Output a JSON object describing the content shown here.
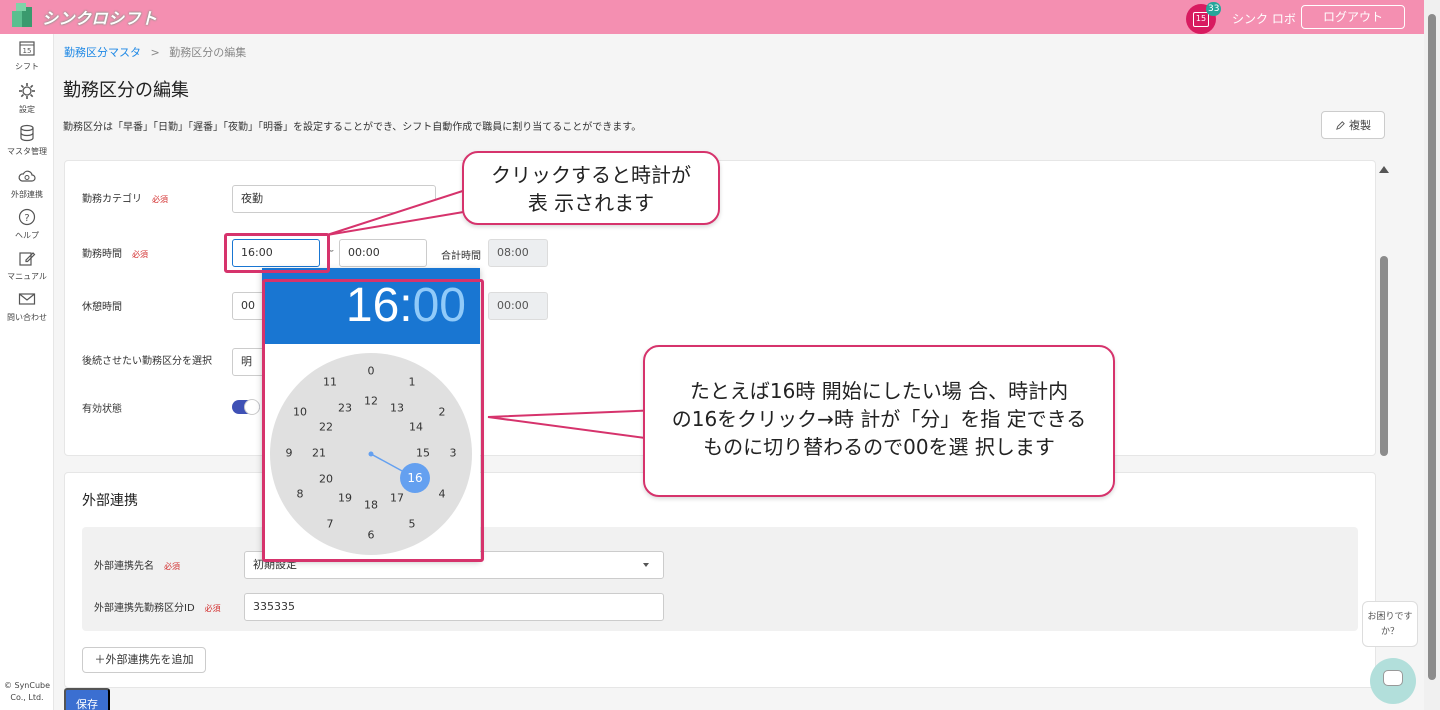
{
  "header": {
    "logo_text": "シンクロシフト",
    "notification_count": "33",
    "calendar_day": "15",
    "user_name": "シンク ロボ",
    "logout_label": "ログアウト"
  },
  "sidebar": {
    "items": [
      {
        "label": "シフト",
        "icon": "calendar-icon",
        "icon_text": "15"
      },
      {
        "label": "設定",
        "icon": "gear-icon"
      },
      {
        "label": "マスタ管理",
        "icon": "database-icon"
      },
      {
        "label": "外部連携",
        "icon": "cloud-sync-icon"
      },
      {
        "label": "ヘルプ",
        "icon": "help-icon"
      },
      {
        "label": "マニュアル",
        "icon": "edit-icon"
      },
      {
        "label": "問い合わせ",
        "icon": "mail-icon"
      }
    ],
    "copyright": "© SynCube Co., Ltd."
  },
  "breadcrumb": {
    "parent": "勤務区分マスタ",
    "separator": ">",
    "current": "勤務区分の編集"
  },
  "page": {
    "title": "勤務区分の編集",
    "description": "勤務区分は「早番」「日勤」「遅番」「夜勤」「明番」を設定することができ、シフト自動作成で職員に割り当てることができます。",
    "copy_button": "複製"
  },
  "form": {
    "category_label": "勤務カテゴリ",
    "required": "必須",
    "category_value": "夜勤",
    "time_label": "勤務時間",
    "start_time": "16:00",
    "tilde": "~",
    "end_time": "00:00",
    "total_label": "合計時間",
    "total_value": "08:00",
    "break_label": "休憩時間",
    "break_value": "00",
    "break_total": "00:00",
    "next_label": "後続させたい勤務区分を選択",
    "next_value": "明",
    "active_label": "有効状態",
    "active_on": true
  },
  "external": {
    "title": "外部連携",
    "dest_label": "外部連携先名",
    "dest_value": "初期設定",
    "id_label": "外部連携先勤務区分ID",
    "id_value": "335335",
    "add_button": "＋外部連携先を追加",
    "save_button": "保存"
  },
  "clock": {
    "hours": "16",
    "colon": ":",
    "minutes": "00",
    "selected": "16",
    "outer": [
      "0",
      "1",
      "2",
      "3",
      "4",
      "5",
      "6",
      "7",
      "8",
      "9",
      "10",
      "11"
    ],
    "inner": [
      "12",
      "13",
      "14",
      "15",
      "16",
      "17",
      "18",
      "19",
      "20",
      "21",
      "22",
      "23"
    ]
  },
  "callouts": {
    "first_line1": "クリックすると時計が",
    "first_line2": "表 示されます",
    "second_line1": "たとえば16時 開始にしたい場 合、時計内",
    "second_line2": "の16をクリック→時 計が「分」を指 定できる",
    "second_line3": "ものに切り替わるので00を選 択します"
  },
  "help": {
    "bubble": "お困りですか？"
  },
  "colors": {
    "header": "#f48fb1",
    "accent": "#1976d2",
    "callout_border": "#d6336c"
  }
}
